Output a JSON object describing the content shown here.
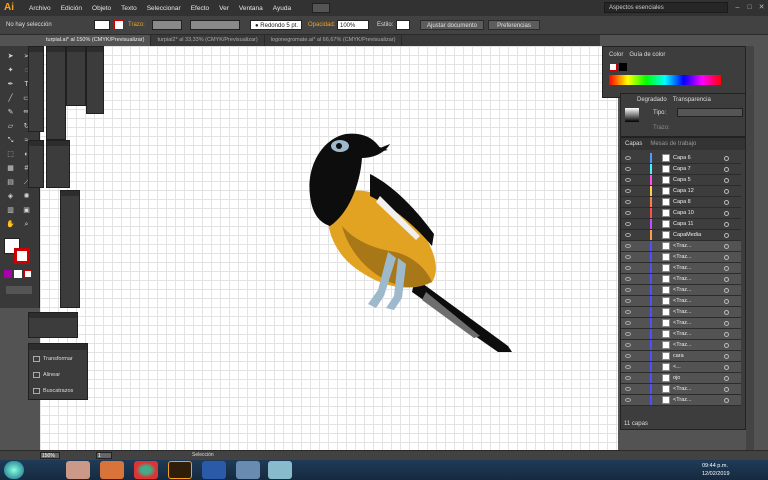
{
  "app": {
    "logo": "Ai",
    "menus": [
      "Archivo",
      "Edición",
      "Objeto",
      "Texto",
      "Seleccionar",
      "Efecto",
      "Ver",
      "Ventana",
      "Ayuda"
    ],
    "workspace": "Aspectos esenciales"
  },
  "control_bar": {
    "selection_state": "No hay selección",
    "stroke_label": "Trazo:",
    "brush": "Redondo 5 pt.",
    "opacity_label": "Opacidad:",
    "opacity_value": "100%",
    "style_label": "Estilo:",
    "adjust_doc_button": "Ajustar documento",
    "prefs_button": "Preferencias"
  },
  "tabs": [
    {
      "label": "turpial.ai* al 150% (CMYK/Previsualizar)",
      "active": true
    },
    {
      "label": "turpial2* al 33,33% (CMYK/Previsualizar)",
      "active": false
    },
    {
      "label": "logonegromate.ai* al 66,67% (CMYK/Previsualizar)",
      "active": false
    }
  ],
  "color_panel": {
    "tabs": [
      "Color",
      "Guía de color"
    ]
  },
  "gradient_panel": {
    "tabs": [
      "Degradado",
      "Transparencia"
    ],
    "type_label": "Tipo:",
    "stroke_label": "Trazo:"
  },
  "layers_panel": {
    "tabs": [
      "Capas",
      "Mesas de trabajo"
    ],
    "rows": [
      {
        "name": "Capa 6",
        "color": "#4f9bff",
        "sub": false
      },
      {
        "name": "Capa 7",
        "color": "#4ff0ff",
        "sub": false
      },
      {
        "name": "Capa 5",
        "color": "#ff4ff0",
        "sub": false
      },
      {
        "name": "Capa 12",
        "color": "#ffd04f",
        "sub": false
      },
      {
        "name": "Capa 8",
        "color": "#ff7f4f",
        "sub": false
      },
      {
        "name": "Capa 10",
        "color": "#ff4f4f",
        "sub": false
      },
      {
        "name": "Capa 11",
        "color": "#c04fff",
        "sub": false
      },
      {
        "name": "CapaMedia",
        "color": "#ff9f3f",
        "sub": false
      },
      {
        "name": "<Traz...",
        "color": "#4f4fff",
        "sub": true
      },
      {
        "name": "<Traz...",
        "color": "#4f4fff",
        "sub": true
      },
      {
        "name": "<Traz...",
        "color": "#4f4fff",
        "sub": true
      },
      {
        "name": "<Traz...",
        "color": "#4f4fff",
        "sub": true
      },
      {
        "name": "<Traz...",
        "color": "#4f4fff",
        "sub": true
      },
      {
        "name": "<Traz...",
        "color": "#4f4fff",
        "sub": true
      },
      {
        "name": "<Traz...",
        "color": "#4f4fff",
        "sub": true
      },
      {
        "name": "<Traz...",
        "color": "#4f4fff",
        "sub": true
      },
      {
        "name": "<Traz...",
        "color": "#4f4fff",
        "sub": true
      },
      {
        "name": "<Traz...",
        "color": "#4f4fff",
        "sub": true
      },
      {
        "name": "cara",
        "color": "#4f4fff",
        "sub": true
      },
      {
        "name": "<...",
        "color": "#4f4fff",
        "sub": true
      },
      {
        "name": "ojo",
        "color": "#4f4fff",
        "sub": true
      },
      {
        "name": "<Traz...",
        "color": "#4f4fff",
        "sub": true
      },
      {
        "name": "<Traz...",
        "color": "#4f4fff",
        "sub": true
      }
    ],
    "footer": "11 capas"
  },
  "transform_panel": {
    "items": [
      "Transformar",
      "Alinear",
      "Buscatrazos"
    ]
  },
  "status_bar": {
    "zoom": "150%",
    "artboard": "1",
    "tool": "Selección"
  },
  "taskbar": {
    "time": "09:44 p.m.",
    "date": "12/02/2019"
  },
  "colors": {
    "bird_black": "#0d0d0d",
    "bird_yellow": "#e3a322",
    "bird_shadow": "#a87718",
    "legs": "#9fb9cc"
  }
}
